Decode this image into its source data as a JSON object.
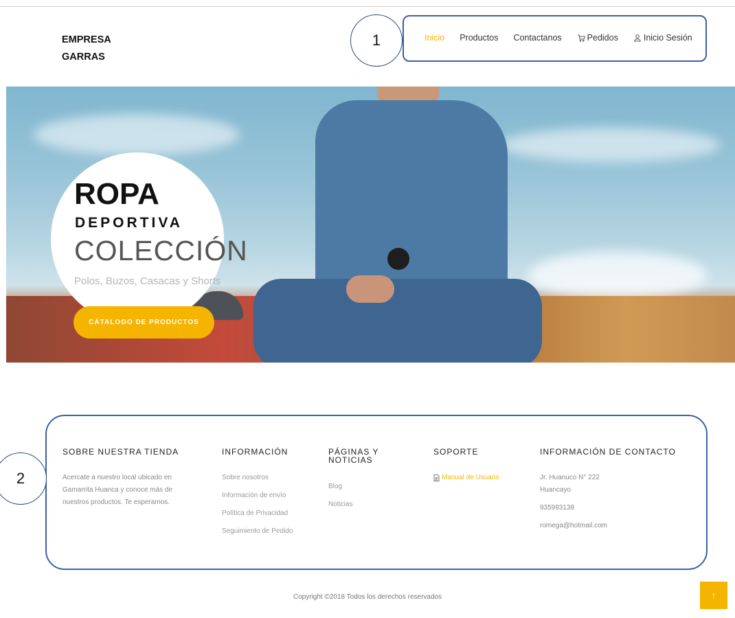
{
  "brand": {
    "line1": "EMPRESA",
    "line2": "GARRAS"
  },
  "annotations": {
    "nav_marker": "1",
    "footer_marker": "2"
  },
  "nav": {
    "items": [
      {
        "label": "Inicio",
        "active": true
      },
      {
        "label": "Productos"
      },
      {
        "label": "Contactanos"
      },
      {
        "label": "Pedidos",
        "icon": "cart-icon"
      },
      {
        "label": "Inicio Sesión",
        "icon": "user-icon"
      }
    ]
  },
  "hero": {
    "title": "ROPA",
    "subtitle": "DEPORTIVA",
    "collection": "COLECCIÓN",
    "description": "Polos, Buzos, Casacas y Shorts",
    "cta_label": "CÁTALOGO DE PRODUCTOS"
  },
  "footer": {
    "about": {
      "heading": "SOBRE NUESTRA TIENDA",
      "lines": [
        "Acercate a nuestro local ubicado en",
        "Gamarrita Huanca y conoce más de",
        "nuestros productos. Te esperamos."
      ]
    },
    "info": {
      "heading": "INFORMACIÓN",
      "links": [
        "Sobre nosotros",
        "Información de envío",
        "Política de Privacidad",
        "Seguimiento de Pedido"
      ]
    },
    "pages": {
      "heading_line1": "PÁGINAS Y",
      "heading_line2": "NOTICIAS",
      "links": [
        "Blog",
        "Noticias"
      ]
    },
    "support": {
      "heading": "SOPORTE",
      "links": [
        {
          "label": "Manual de Usuario",
          "icon": "document-icon"
        }
      ]
    },
    "contact": {
      "heading": "INFORMACIÓN DE CONTACTO",
      "address1": "Jr. Huanuco N° 222",
      "address2": "Huancayo",
      "phone": "935993138",
      "email": "romega@hotmail.com"
    }
  },
  "copyright": "Copyright ©2018 Todos los derechos reservados",
  "scroll_top_icon": "arrow-up-icon",
  "colors": {
    "accent": "#f5b400",
    "annotation_border": "#3b5fa8"
  }
}
